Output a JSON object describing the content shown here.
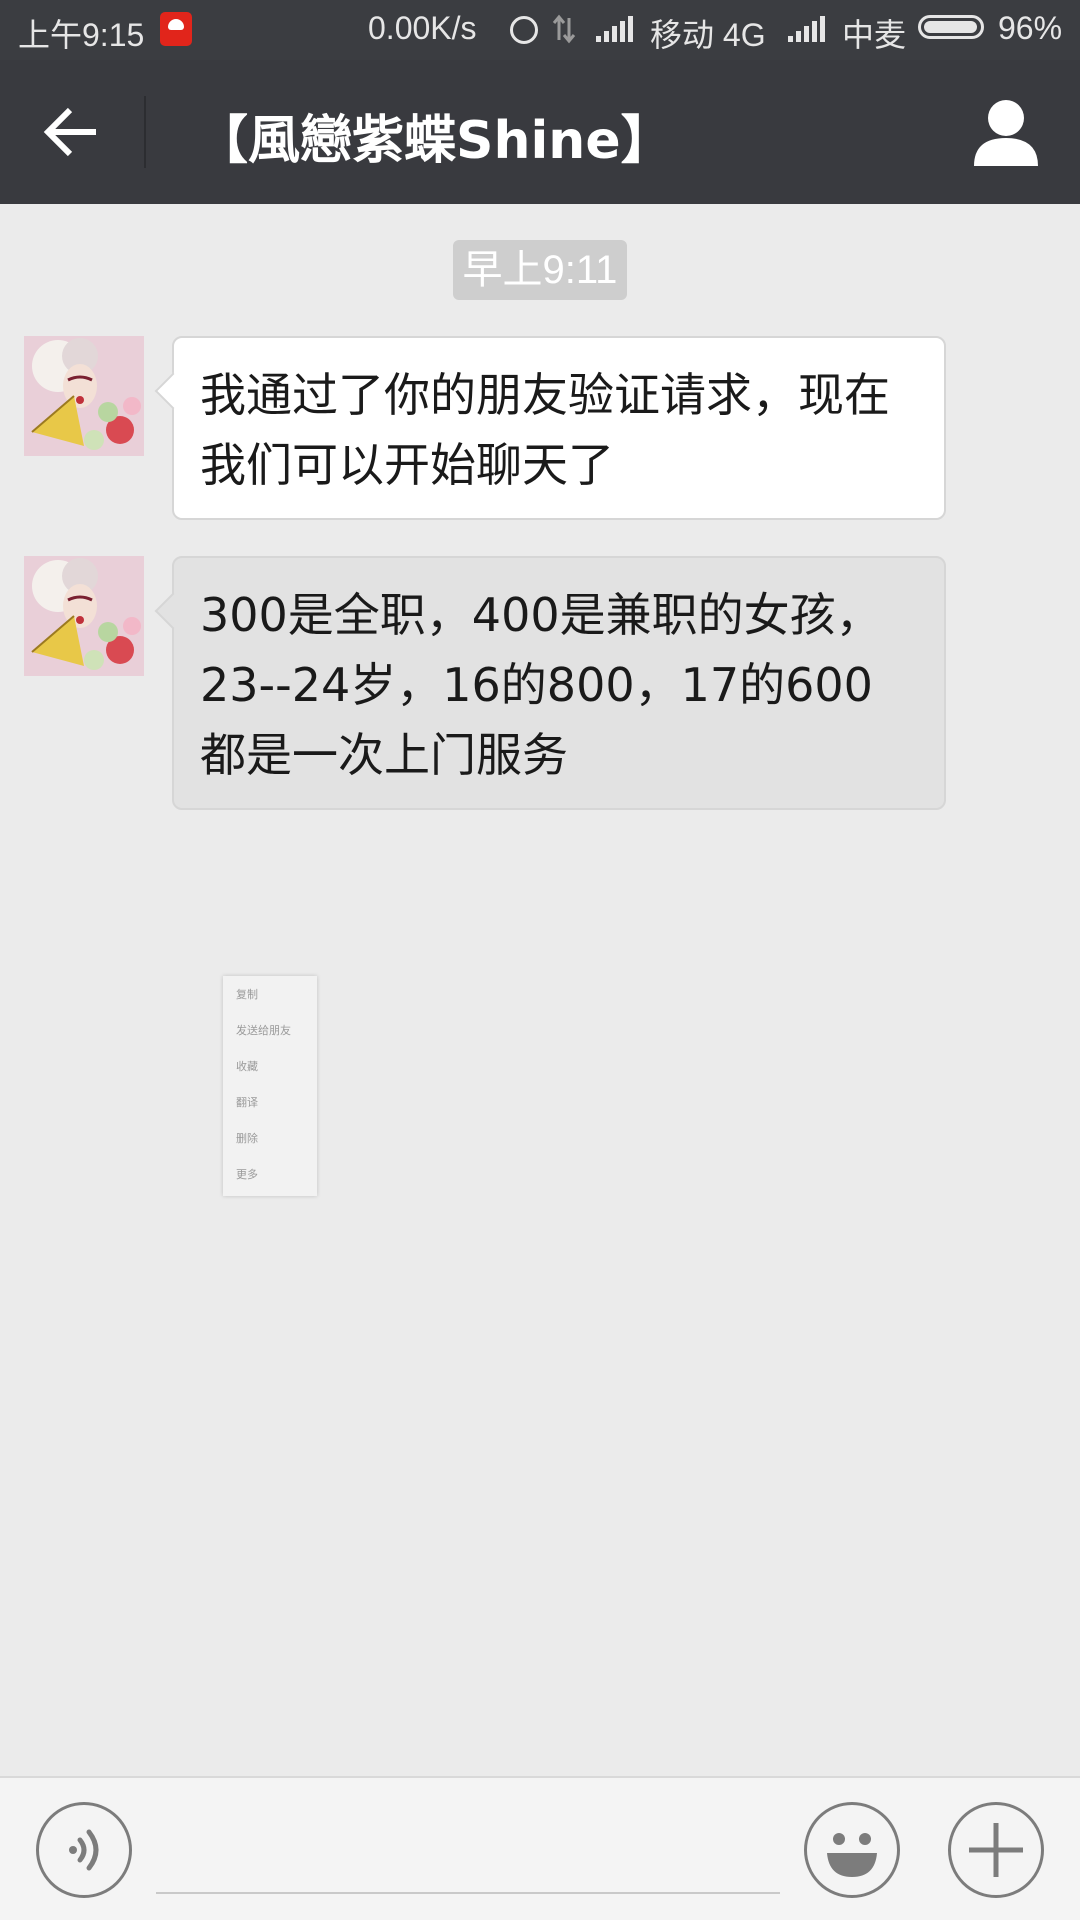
{
  "status_bar": {
    "time": "上午9:15",
    "notification_icon": "jd-app-icon",
    "net_speed": "0.00K/s",
    "alarm_icon": "alarm-icon",
    "data_icon": "data-transfer-icon",
    "carrier1": "移动 4G",
    "carrier2": "中麦",
    "battery_percent": "96%",
    "battery_level": 0.96
  },
  "header": {
    "title": "【風戀紫蝶Shine】",
    "back_icon": "back-arrow-icon",
    "profile_icon": "person-icon"
  },
  "chat": {
    "timestamp": "早上9:11",
    "messages": [
      {
        "sender": "contact",
        "text": "我通过了你的朋友验证请求，现在我们可以开始聊天了"
      },
      {
        "sender": "contact",
        "text": "300是全职，400是兼职的女孩，23--24岁，16的800，17的600都是一次上门服务"
      }
    ]
  },
  "context_menu": {
    "items": [
      "复制",
      "发送给朋友",
      "收藏",
      "翻译",
      "删除",
      "更多"
    ]
  },
  "input_bar": {
    "voice_icon": "voice-icon",
    "emoji_icon": "emoji-icon",
    "plus_icon": "plus-icon",
    "input_value": "",
    "input_placeholder": ""
  },
  "colors": {
    "status_bar_bg": "#3b3d41",
    "nav_bar_bg": "#393a3f",
    "chat_bg": "#ebebeb",
    "bubble_white": "#ffffff",
    "bubble_selected": "#e2e2e2"
  }
}
